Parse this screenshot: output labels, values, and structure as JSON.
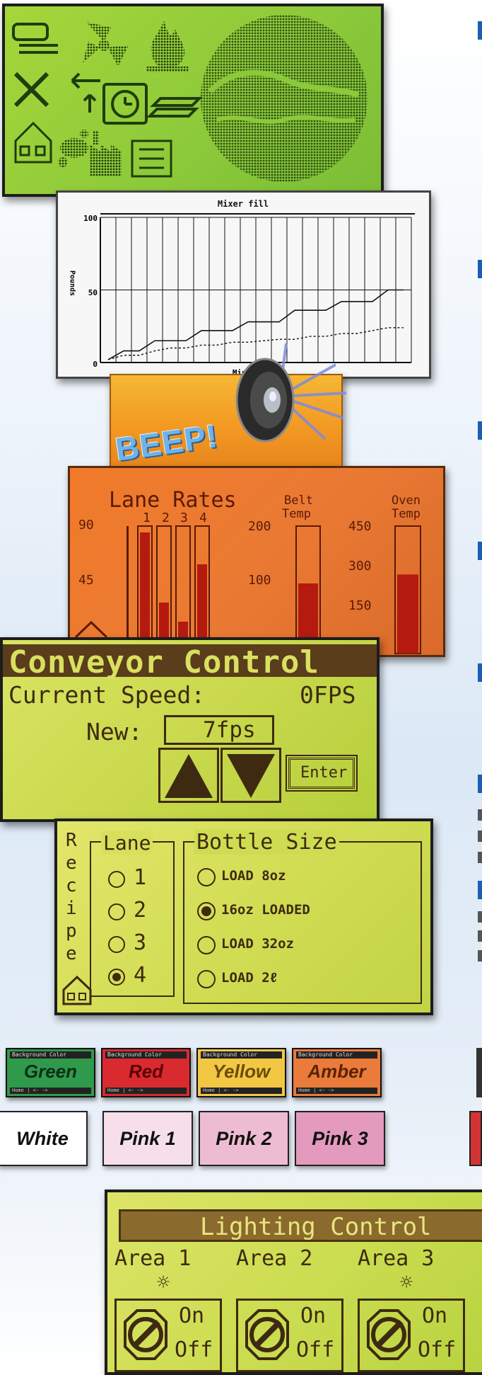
{
  "icon_panel": {
    "icons": [
      "fan-icon",
      "fire-icon",
      "pot-icon",
      "tools-icon",
      "arrows-icon",
      "clock-icon",
      "stack-icon",
      "home-icon",
      "foot-icon",
      "factory-icon",
      "list-icon",
      "globe-icon"
    ]
  },
  "mixer_chart": {
    "title": "Mixer fill",
    "ylabel": "Pounds",
    "xlabel": "Minutes",
    "yticks": [
      "100",
      "50",
      "0"
    ]
  },
  "chart_data": {
    "type": "line",
    "title": "Mixer fill",
    "xlabel": "Minutes",
    "ylabel": "Pounds",
    "ylim": [
      0,
      100
    ],
    "x": [
      0,
      1,
      2,
      3,
      4,
      5,
      6,
      7,
      8,
      9,
      10,
      11,
      12,
      13,
      14,
      15,
      16,
      17,
      18,
      19
    ],
    "series": [
      {
        "values": [
          2,
          8,
          8,
          15,
          15,
          15,
          22,
          22,
          22,
          28,
          28,
          28,
          36,
          36,
          36,
          42,
          42,
          42,
          50,
          50
        ]
      },
      {
        "values": [
          2,
          5,
          5,
          8,
          10,
          10,
          12,
          12,
          14,
          14,
          15,
          16,
          16,
          18,
          18,
          20,
          20,
          22,
          24,
          24
        ]
      }
    ]
  },
  "beep": {
    "text": "BEEP!",
    "icon": "speaker-icon"
  },
  "lane_rates": {
    "title": "Lane Rates",
    "lanes": [
      "1",
      "2",
      "3",
      "4"
    ],
    "ticks_left": [
      "90",
      "45"
    ],
    "belt_label_1": "Belt",
    "belt_label_2": "Temp",
    "belt_ticks": [
      "200",
      "100"
    ],
    "oven_label_1": "Oven",
    "oven_label_2": "Temp",
    "oven_ticks": [
      "450",
      "300",
      "150"
    ],
    "lane_levels": [
      0.95,
      0.4,
      0.25,
      0.7
    ],
    "belt_level": 0.55,
    "oven_level": 0.62
  },
  "conveyor": {
    "title": "Conveyor Control",
    "current_label": "Current Speed:",
    "current_value": "0FPS",
    "new_label": "New:",
    "new_value": "7fps",
    "enter_label": "Enter"
  },
  "recipe": {
    "side_label": "Recipe",
    "lane_title": "Lane",
    "lanes": [
      "1",
      "2",
      "3",
      "4"
    ],
    "lane_selected": "4",
    "bottle_title": "Bottle Size",
    "bottles": [
      "LOAD 8oz",
      "16oz LOADED",
      "LOAD 32oz",
      "LOAD 2ℓ"
    ],
    "bottle_selected": "16oz LOADED"
  },
  "swatches_row1": [
    {
      "label": "Green",
      "header": "Background Color",
      "footer": "Home  |  <-  ->",
      "bg": "#2f9a4c",
      "fg": "#0d2f16"
    },
    {
      "label": "Red",
      "header": "Background Color",
      "footer": "Home  |  <-  ->",
      "bg": "#d92a2f",
      "fg": "#5a0507"
    },
    {
      "label": "Yellow",
      "header": "Background Color",
      "footer": "Home  |  <-  ->",
      "bg": "#f2c744",
      "fg": "#6b4b05"
    },
    {
      "label": "Amber",
      "header": "Background Color",
      "footer": "Home  |  <-  ->",
      "bg": "#ea7b3b",
      "fg": "#5a2405"
    }
  ],
  "swatches_row2": [
    {
      "label": "White",
      "bg": "#ffffff"
    },
    {
      "label": "Pink 1",
      "bg": "#f6dfe9"
    },
    {
      "label": "Pink 2",
      "bg": "#eebcd2"
    },
    {
      "label": "Pink 3",
      "bg": "#e49abd"
    }
  ],
  "lighting": {
    "title": "Lighting Control",
    "areas": [
      {
        "name": "Area 1",
        "sun": true,
        "on": "On",
        "off": "Off"
      },
      {
        "name": "Area 2",
        "sun": false,
        "on": "On",
        "off": "Off"
      },
      {
        "name": "Area 3",
        "sun": true,
        "on": "On",
        "off": "Off"
      }
    ]
  }
}
